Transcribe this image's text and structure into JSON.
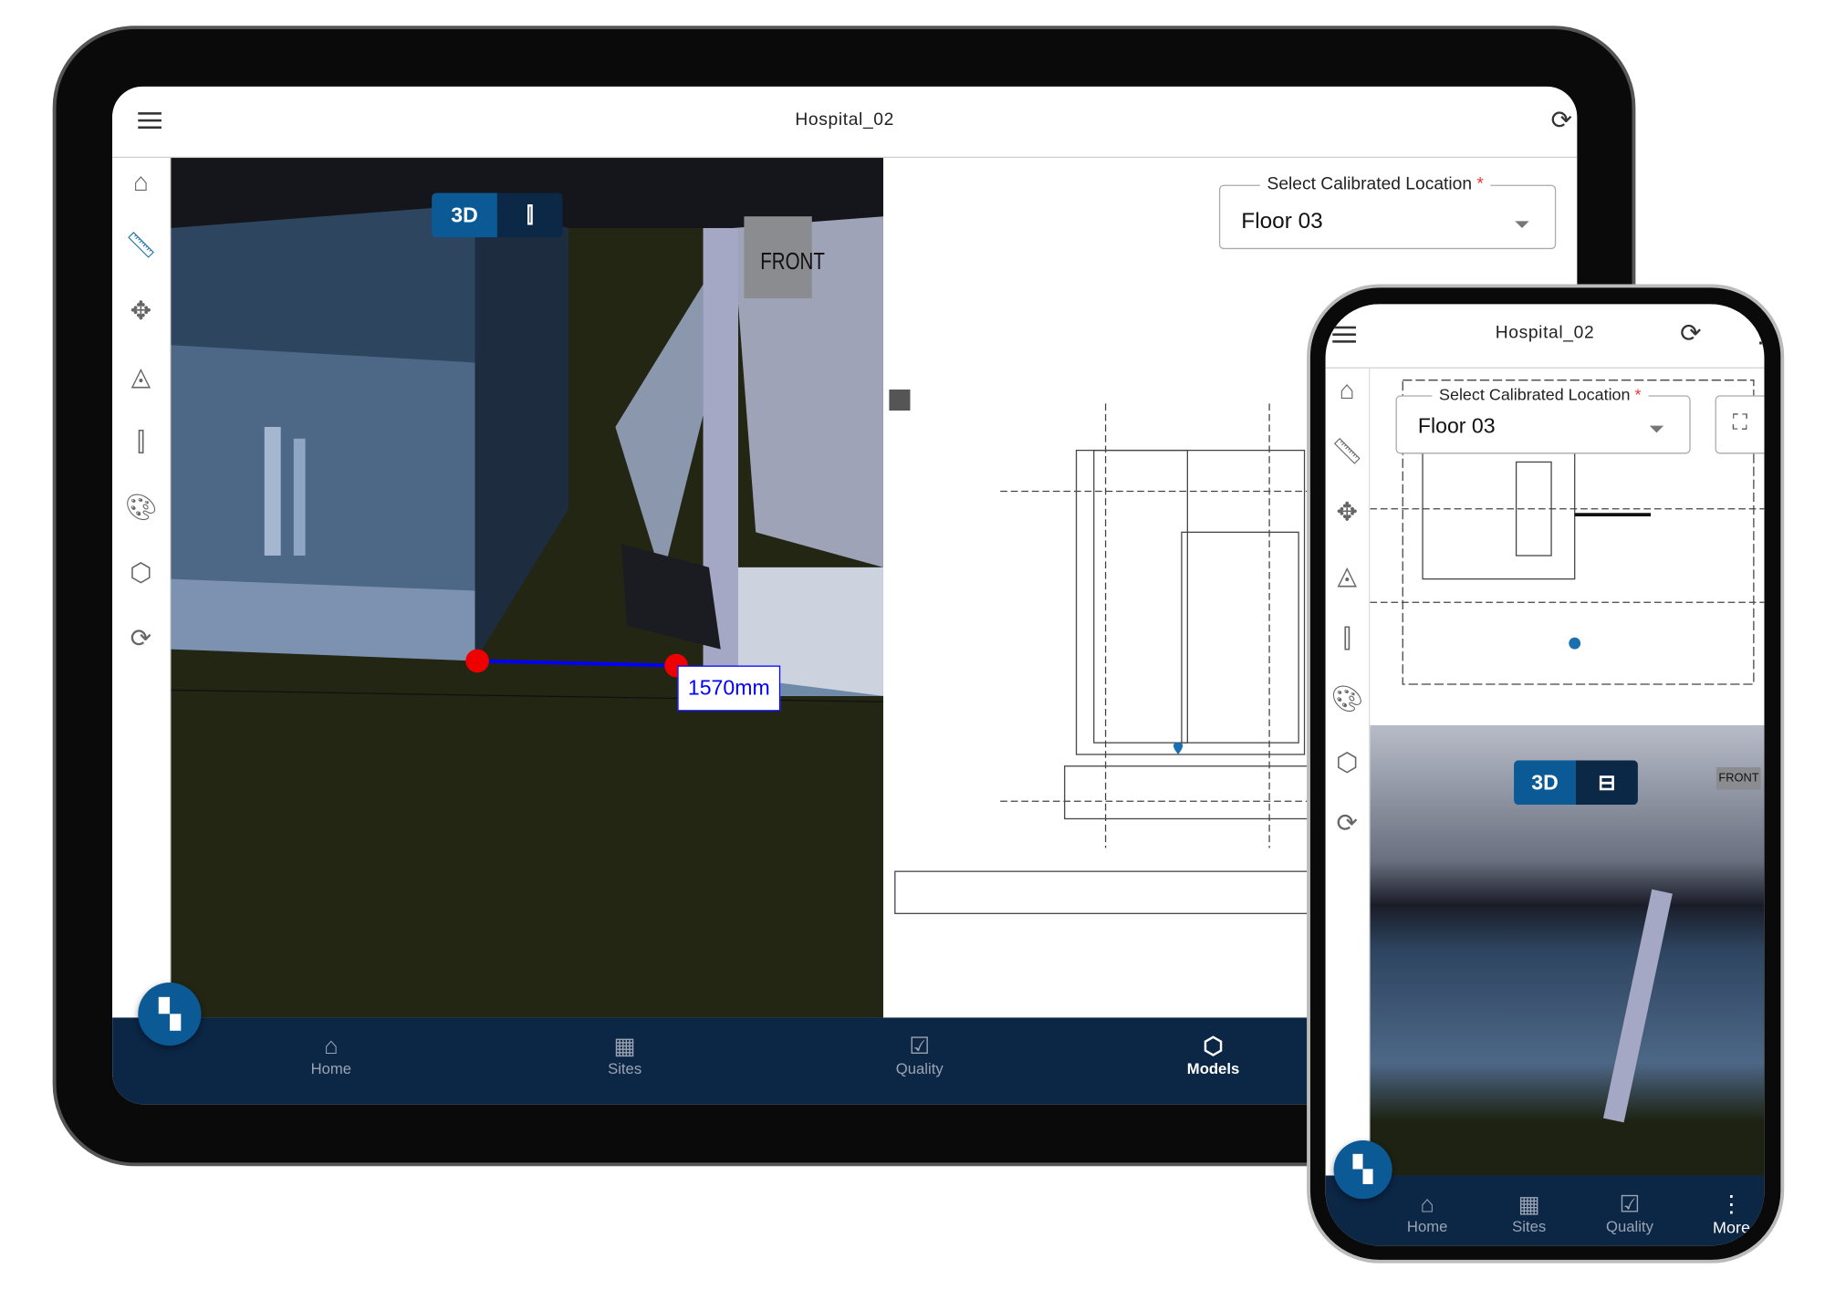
{
  "tablet": {
    "header": {
      "title": "Hospital_02",
      "menu_icon": "hamburger-icon",
      "sync_icon": "sync-icon"
    },
    "sidebar": [
      "home-icon",
      "ruler-icon",
      "orbit-icon",
      "navigate-icon",
      "section-icon",
      "palette-icon",
      "cube-icon",
      "refresh-icon"
    ],
    "toggle": {
      "mode_3d": "3D",
      "mode_split": "split-view-icon"
    },
    "measurement": {
      "label": "1570mm",
      "color": "#0000ff"
    },
    "scene_sign": "FRONT",
    "select": {
      "label": "Select Calibrated Location",
      "required": "*",
      "value": "Floor 03"
    },
    "nav": [
      {
        "label": "Home",
        "icon": "home-icon"
      },
      {
        "label": "Sites",
        "icon": "floorplan-icon"
      },
      {
        "label": "Quality",
        "icon": "clipboard-check-icon"
      },
      {
        "label": "Models",
        "icon": "cube-icon",
        "active": true
      }
    ]
  },
  "phone": {
    "header": {
      "title": "Hospital_02",
      "menu_icon": "hamburger-icon",
      "sync_icon": "sync-icon",
      "more_icon": "more-vertical-icon"
    },
    "select": {
      "label": "Select Calibrated Location",
      "required": "*",
      "value": "Floor 03"
    },
    "toggle": {
      "mode_3d": "3D"
    },
    "scene_sign": "FRONT",
    "nav": [
      {
        "label": "Home",
        "icon": "home-icon"
      },
      {
        "label": "Sites",
        "icon": "floorplan-icon"
      },
      {
        "label": "Quality",
        "icon": "clipboard-check-icon"
      },
      {
        "label": "More",
        "icon": "more-vertical-icon",
        "active": true
      }
    ]
  },
  "colors": {
    "navy": "#0c2646",
    "accent": "#0b5a96",
    "required": "#e33333"
  }
}
